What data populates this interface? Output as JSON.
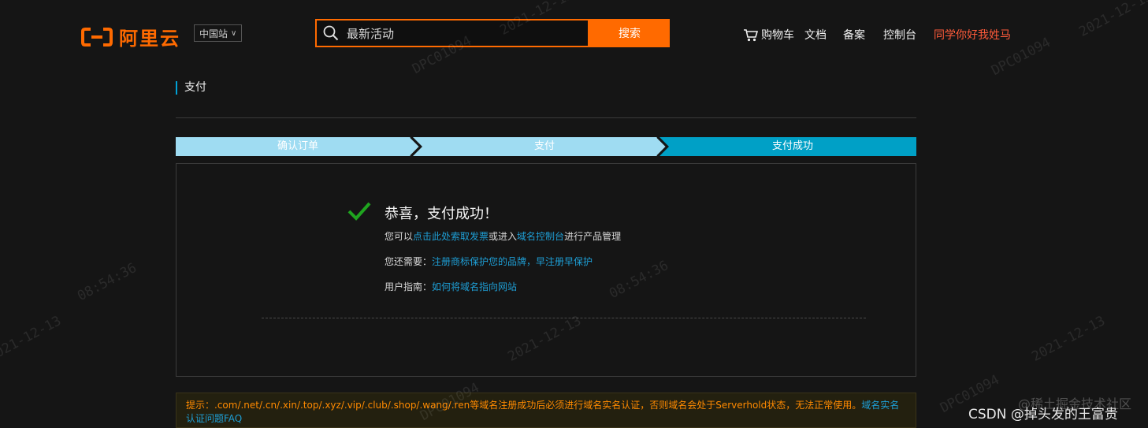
{
  "header": {
    "logo_text": "阿里云",
    "region": "中国站",
    "search_value": "最新活动",
    "search_button": "搜索",
    "nav": {
      "cart": "购物车",
      "docs": "文档",
      "filing": "备案",
      "console": "控制台",
      "user": "同学你好我姓马"
    }
  },
  "page": {
    "section_title": "支付",
    "steps": [
      "确认订单",
      "支付",
      "支付成功"
    ],
    "success_title": "恭喜，支付成功！",
    "line1": {
      "prefix": "您可以",
      "link1": "点击此处索取发票",
      "middle": "或进入",
      "link2": "域名控制台",
      "suffix": "进行产品管理"
    },
    "line2": {
      "prefix": "您还需要：",
      "link": "注册商标保护您的品牌，早注册早保护"
    },
    "line3": {
      "prefix": "用户指南：",
      "link": "如何将域名指向网站"
    },
    "tip": {
      "text": "提示：.com/.net/.cn/.xin/.top/.xyz/.vip/.club/.shop/.wang/.ren等域名注册成功后必须进行域名实名认证，否则域名会处于Serverhold状态，无法正常使用。",
      "link": "域名实名认证问题FAQ"
    }
  },
  "watermark": {
    "id": "DPC01094",
    "date": "2021-12-13",
    "time": "08:54:36"
  },
  "credits": {
    "csdn": "CSDN @掉头发的王富贵",
    "juejin": "@稀土掘金技术社区"
  },
  "colors": {
    "accent": "#ff6a00",
    "step_light": "#9fdcf2",
    "step_active": "#00a0c6",
    "link": "#1e9fd6",
    "check": "#1fa51f"
  }
}
